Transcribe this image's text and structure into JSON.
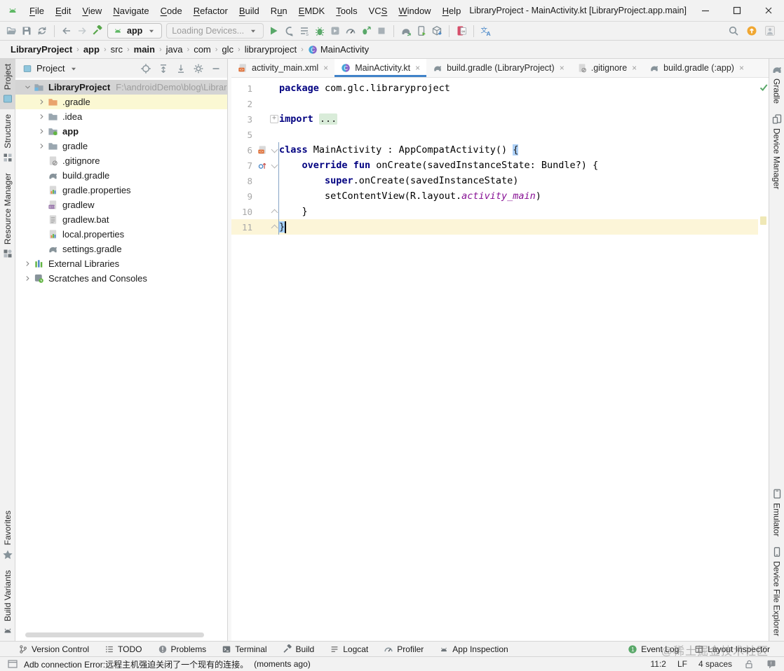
{
  "window": {
    "title": "LibraryProject - MainActivity.kt [LibraryProject.app.main]"
  },
  "menubar": {
    "items": [
      {
        "label": "File",
        "mnemonic": 0
      },
      {
        "label": "Edit",
        "mnemonic": 0
      },
      {
        "label": "View",
        "mnemonic": 0
      },
      {
        "label": "Navigate",
        "mnemonic": 0
      },
      {
        "label": "Code",
        "mnemonic": 0
      },
      {
        "label": "Refactor",
        "mnemonic": 0
      },
      {
        "label": "Build",
        "mnemonic": 0
      },
      {
        "label": "Run",
        "mnemonic": 1
      },
      {
        "label": "EMDK",
        "mnemonic": 0
      },
      {
        "label": "Tools",
        "mnemonic": 0
      },
      {
        "label": "VCS",
        "mnemonic": 2
      },
      {
        "label": "Window",
        "mnemonic": 0
      },
      {
        "label": "Help",
        "mnemonic": 0
      }
    ]
  },
  "toolbar": {
    "run_config": "app",
    "device_selector": "Loading Devices..."
  },
  "breadcrumb": {
    "items": [
      {
        "label": "LibraryProject",
        "bold": true
      },
      {
        "label": "app",
        "bold": true
      },
      {
        "label": "src",
        "bold": false
      },
      {
        "label": "main",
        "bold": true
      },
      {
        "label": "java",
        "bold": false
      },
      {
        "label": "com",
        "bold": false
      },
      {
        "label": "glc",
        "bold": false
      },
      {
        "label": "libraryproject",
        "bold": false
      },
      {
        "label": "MainActivity",
        "bold": false,
        "icon": "kotlin"
      }
    ]
  },
  "left_strip": {
    "top": [
      {
        "label": "Project",
        "icon": "project-tab",
        "selected": true
      },
      {
        "label": "Structure",
        "icon": "structure"
      },
      {
        "label": "Resource Manager",
        "icon": "resource"
      }
    ],
    "bottom": [
      {
        "label": "Favorites",
        "icon": "star"
      },
      {
        "label": "Build Variants",
        "icon": "android-gray"
      }
    ]
  },
  "right_strip": {
    "top": [
      {
        "label": "Gradle",
        "icon": "gradle"
      },
      {
        "label": "Device Manager",
        "icon": "devices"
      }
    ],
    "bottom": [
      {
        "label": "Emulator",
        "icon": "emulator"
      },
      {
        "label": "Device File Explorer",
        "icon": "phone"
      }
    ]
  },
  "project_panel": {
    "header": {
      "title": "Project"
    },
    "tree": [
      {
        "label": "LibraryProject",
        "icon": "project",
        "indent": 0,
        "chevron": "down",
        "bold": true,
        "selected": true,
        "suffix": "F:\\androidDemo\\blog\\Librar"
      },
      {
        "label": ".gradle",
        "icon": "folder-orange",
        "indent": 1,
        "chevron": "right",
        "highlight": true
      },
      {
        "label": ".idea",
        "icon": "folder",
        "indent": 1,
        "chevron": "right"
      },
      {
        "label": "app",
        "icon": "folder-android",
        "indent": 1,
        "chevron": "right",
        "bold": true
      },
      {
        "label": "gradle",
        "icon": "folder",
        "indent": 1,
        "chevron": "right"
      },
      {
        "label": ".gitignore",
        "icon": "ignored",
        "indent": 1
      },
      {
        "label": "build.gradle",
        "icon": "gradle",
        "indent": 1
      },
      {
        "label": "gradle.properties",
        "icon": "props",
        "indent": 1
      },
      {
        "label": "gradlew",
        "icon": "script",
        "indent": 1
      },
      {
        "label": "gradlew.bat",
        "icon": "textfile",
        "indent": 1
      },
      {
        "label": "local.properties",
        "icon": "props",
        "indent": 1
      },
      {
        "label": "settings.gradle",
        "icon": "gradle",
        "indent": 1
      },
      {
        "label": "External Libraries",
        "icon": "lib",
        "indent": 0,
        "chevron": "right"
      },
      {
        "label": "Scratches and Consoles",
        "icon": "scratch",
        "indent": 0,
        "chevron": "right"
      }
    ]
  },
  "editor": {
    "tabs": [
      {
        "label": "activity_main.xml",
        "icon": "xml"
      },
      {
        "label": "MainActivity.kt",
        "icon": "kotlin",
        "active": true
      },
      {
        "label": "build.gradle (LibraryProject)",
        "icon": "gradle"
      },
      {
        "label": ".gitignore",
        "icon": "ignored"
      },
      {
        "label": "build.gradle (:app)",
        "icon": "gradle"
      }
    ],
    "code": {
      "lines": [
        {
          "num": "1",
          "tokens": [
            [
              "kw",
              "package"
            ],
            [
              "pl",
              " com.glc.libraryproject"
            ]
          ]
        },
        {
          "num": "2",
          "tokens": []
        },
        {
          "num": "3",
          "tokens": [
            [
              "kw",
              "import"
            ],
            [
              "pl",
              " "
            ],
            [
              "fold",
              "..."
            ]
          ],
          "fold": "plus"
        },
        {
          "num": "5",
          "tokens": []
        },
        {
          "num": "6",
          "tokens": [
            [
              "kw",
              "class"
            ],
            [
              "pl",
              " MainActivity : AppCompatActivity() "
            ],
            [
              "brace",
              "{"
            ]
          ],
          "gutter": "layout",
          "fold": "open"
        },
        {
          "num": "7",
          "tokens": [
            [
              "pl",
              "    "
            ],
            [
              "kw",
              "override"
            ],
            [
              "pl",
              " "
            ],
            [
              "kw",
              "fun"
            ],
            [
              "pl",
              " onCreate(savedInstanceState: Bundle?) {"
            ]
          ],
          "gutter": "override",
          "fold": "open"
        },
        {
          "num": "8",
          "tokens": [
            [
              "pl",
              "        "
            ],
            [
              "kw",
              "super"
            ],
            [
              "pl",
              ".onCreate(savedInstanceState)"
            ]
          ]
        },
        {
          "num": "9",
          "tokens": [
            [
              "pl",
              "        setContentView(R.layout."
            ],
            [
              "ref",
              "activity_main"
            ],
            [
              "pl",
              ")"
            ]
          ]
        },
        {
          "num": "10",
          "tokens": [
            [
              "pl",
              "    }"
            ]
          ],
          "fold": "close"
        },
        {
          "num": "11",
          "tokens": [
            [
              "sel",
              "}"
            ]
          ],
          "fold": "close",
          "current": true,
          "caret": true
        }
      ]
    }
  },
  "bottom_bar": {
    "left": [
      {
        "label": "Version Control",
        "icon": "branch"
      },
      {
        "label": "TODO",
        "icon": "todo"
      },
      {
        "label": "Problems",
        "icon": "problem"
      },
      {
        "label": "Terminal",
        "icon": "terminal"
      },
      {
        "label": "Build",
        "icon": "hammer-sm"
      },
      {
        "label": "Logcat",
        "icon": "logcat"
      },
      {
        "label": "Profiler",
        "icon": "gauge"
      },
      {
        "label": "App Inspection",
        "icon": "inspection"
      }
    ],
    "right": [
      {
        "label": "Event Log",
        "icon": "event-badge"
      },
      {
        "label": "Layout Inspector",
        "icon": "layout-insp"
      }
    ]
  },
  "status_bar": {
    "message": "Adb connection Error:远程主机强迫关闭了一个现有的连接。",
    "time": "(moments ago)",
    "caret_position": "11:2",
    "line_separator": "LF",
    "indent": "4 spaces"
  },
  "watermark": "@稀土掘金技术社区"
}
